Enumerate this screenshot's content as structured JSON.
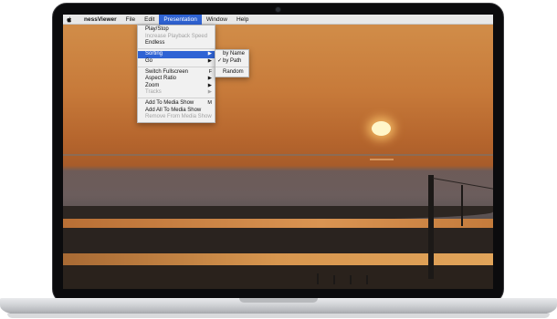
{
  "menubar": {
    "apple_icon": "apple-logo-icon",
    "app_name": "nessViewer",
    "items": [
      "File",
      "Edit",
      "Presentation",
      "Window",
      "Help"
    ]
  },
  "presentation_menu": {
    "items": [
      {
        "label": "Play/Stop"
      },
      {
        "label": "Increase Playback Speed",
        "disabled": true
      },
      {
        "label": "Endless"
      },
      {
        "label": "Sorting",
        "arrow": "▶",
        "highlighted": true
      },
      {
        "label": "Go",
        "arrow": "▶"
      },
      {
        "label": "Switch Fullscreen",
        "shortcut": "F"
      },
      {
        "label": "Aspect Ratio",
        "arrow": "▶"
      },
      {
        "label": "Zoom",
        "arrow": "▶"
      },
      {
        "label": "Tracks",
        "arrow": "▶",
        "disabled": true
      },
      {
        "label": "Add To Media Show",
        "shortcut": "M"
      },
      {
        "label": "Add All To Media Show"
      },
      {
        "label": "Remove From Media Show",
        "disabled": true
      }
    ]
  },
  "sorting_submenu": {
    "items": [
      {
        "label": "by Name"
      },
      {
        "label": "by Path",
        "checked": true
      },
      {
        "label": "Random"
      }
    ],
    "check_mark": "✓"
  },
  "colors": {
    "menu_highlight": "#2f63d4",
    "menubar_bg": "#e8e8e8",
    "menu_bg": "#f1f1f1",
    "disabled_text": "#a3a3a3"
  }
}
